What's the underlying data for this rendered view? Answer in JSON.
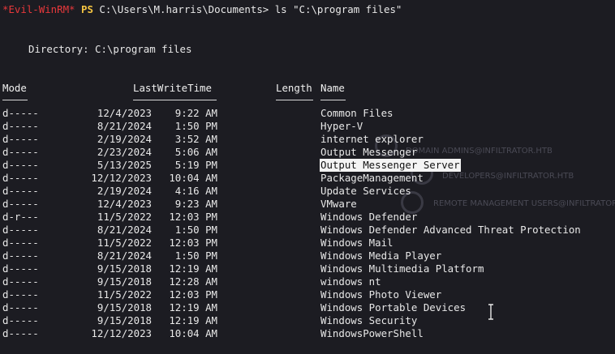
{
  "prompt": {
    "evil_tag": "*Evil-WinRM*",
    "ps": "PS",
    "path_cmd": " C:\\Users\\M.harris\\Documents> ls \"C:\\program files\""
  },
  "directory_line": "Directory: C:\\program files",
  "headers": {
    "mode": "Mode",
    "lastwritetime": "LastWriteTime",
    "length": "Length",
    "name": "Name"
  },
  "rows": [
    {
      "mode": "d-----",
      "date": "12/4/2023",
      "time": "9:22 AM",
      "name": "Common Files"
    },
    {
      "mode": "d-----",
      "date": "8/21/2024",
      "time": "1:50 PM",
      "name": "Hyper-V"
    },
    {
      "mode": "d-----",
      "date": "2/19/2024",
      "time": "3:52 AM",
      "name": "internet explorer"
    },
    {
      "mode": "d-----",
      "date": "2/23/2024",
      "time": "5:06 AM",
      "name": "Output Messenger"
    },
    {
      "mode": "d-----",
      "date": "5/13/2025",
      "time": "5:19 PM",
      "name": "Output Messenger Server"
    },
    {
      "mode": "d-----",
      "date": "12/12/2023",
      "time": "10:04 AM",
      "name": "PackageManagement"
    },
    {
      "mode": "d-----",
      "date": "2/19/2024",
      "time": "4:16 AM",
      "name": "Update Services"
    },
    {
      "mode": "d-----",
      "date": "12/4/2023",
      "time": "9:23 AM",
      "name": "VMware"
    },
    {
      "mode": "d-r---",
      "date": "11/5/2022",
      "time": "12:03 PM",
      "name": "Windows Defender"
    },
    {
      "mode": "d-----",
      "date": "8/21/2024",
      "time": "1:50 PM",
      "name": "Windows Defender Advanced Threat Protection"
    },
    {
      "mode": "d-----",
      "date": "11/5/2022",
      "time": "12:03 PM",
      "name": "Windows Mail"
    },
    {
      "mode": "d-----",
      "date": "8/21/2024",
      "time": "1:50 PM",
      "name": "Windows Media Player"
    },
    {
      "mode": "d-----",
      "date": "9/15/2018",
      "time": "12:19 AM",
      "name": "Windows Multimedia Platform"
    },
    {
      "mode": "d-----",
      "date": "9/15/2018",
      "time": "12:28 AM",
      "name": "windows nt"
    },
    {
      "mode": "d-----",
      "date": "11/5/2022",
      "time": "12:03 PM",
      "name": "Windows Photo Viewer"
    },
    {
      "mode": "d-----",
      "date": "9/15/2018",
      "time": "12:19 AM",
      "name": "Windows Portable Devices"
    },
    {
      "mode": "d-----",
      "date": "9/15/2018",
      "time": "12:19 AM",
      "name": "Windows Security"
    },
    {
      "mode": "d-----",
      "date": "12/12/2023",
      "time": "10:04 AM",
      "name": "WindowsPowerShell"
    }
  ],
  "highlighted_row": 4,
  "ghost_text": [
    "DOMAIN ADMINS@INFILTRATOR.HTB",
    "DEVELOPERS@INFILTRATOR.HTB",
    "REMOTE MANAGEMENT USERS@INFILTRATOR.HTB"
  ]
}
